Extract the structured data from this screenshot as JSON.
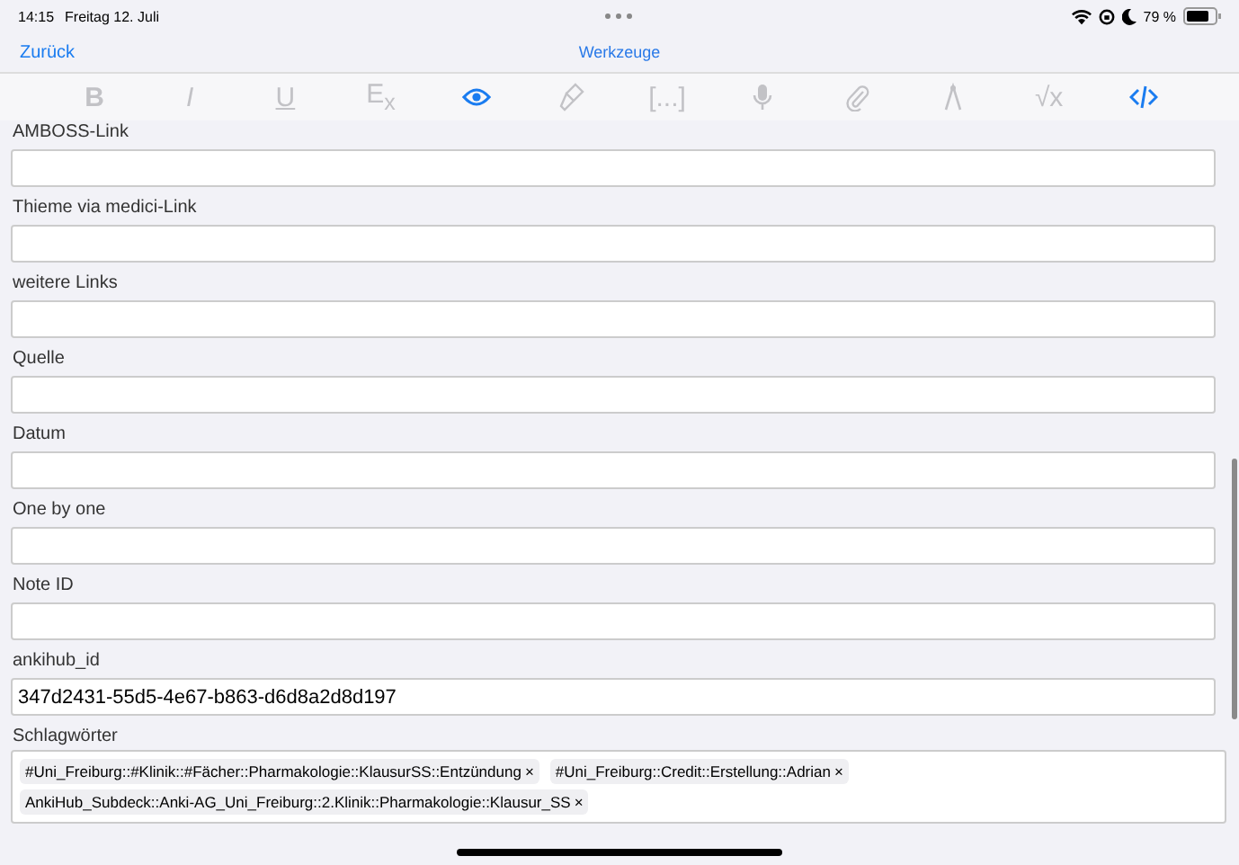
{
  "status_bar": {
    "time": "14:15",
    "date": "Freitag 12. Juli",
    "battery": "79 %"
  },
  "nav": {
    "back": "Zurück",
    "title": "Werkzeuge"
  },
  "toolbar": [
    {
      "kind": "text",
      "label": "**B**",
      "active": false
    },
    {
      "kind": "text",
      "label": "*I*",
      "active": false
    },
    {
      "kind": "underline",
      "label": "U",
      "active": false
    },
    {
      "kind": "text",
      "label": "E$_{x}$",
      "active": false
    },
    {
      "kind": "eye",
      "active": true
    },
    {
      "kind": "brush",
      "active": false
    },
    {
      "kind": "text",
      "label": "[...]",
      "active": false
    },
    {
      "kind": "mic",
      "active": false
    },
    {
      "kind": "clip",
      "active": false
    },
    {
      "kind": "compass",
      "active": false
    },
    {
      "kind": "text",
      "label": "√x",
      "active": false
    },
    {
      "kind": "code",
      "active": true
    }
  ],
  "fields": [
    {
      "label": "AMBOSS-Link"
    },
    {
      "label": "Thieme via medici-Link"
    },
    {
      "label": "weitere Links"
    },
    {
      "label": "Quelle"
    },
    {
      "label": "Datum"
    },
    {
      "label": "One by one"
    },
    {
      "label": "Note ID"
    },
    {
      "label": "ankihub_id",
      "value": "347d2431-55d5-4e67-b863-d6d8a2d8d197"
    }
  ],
  "tags": {
    "label": "Schlagwörter",
    "items": [
      {
        "text": "#Uni_Freiburg::#Klinik::#Fächer::Pharmakologie::KlausurSS::Entzündung",
        "remove": "×"
      },
      {
        "text": "#Uni_Freiburg::Credit::Erstellung::Adrian",
        "remove": "×"
      },
      {
        "text": "AnkiHub_Subdeck::Anki-AG_Uni_Freiburg::2.Klinik::Pharmakologie::Klausur_SS",
        "remove": "×"
      }
    ]
  }
}
